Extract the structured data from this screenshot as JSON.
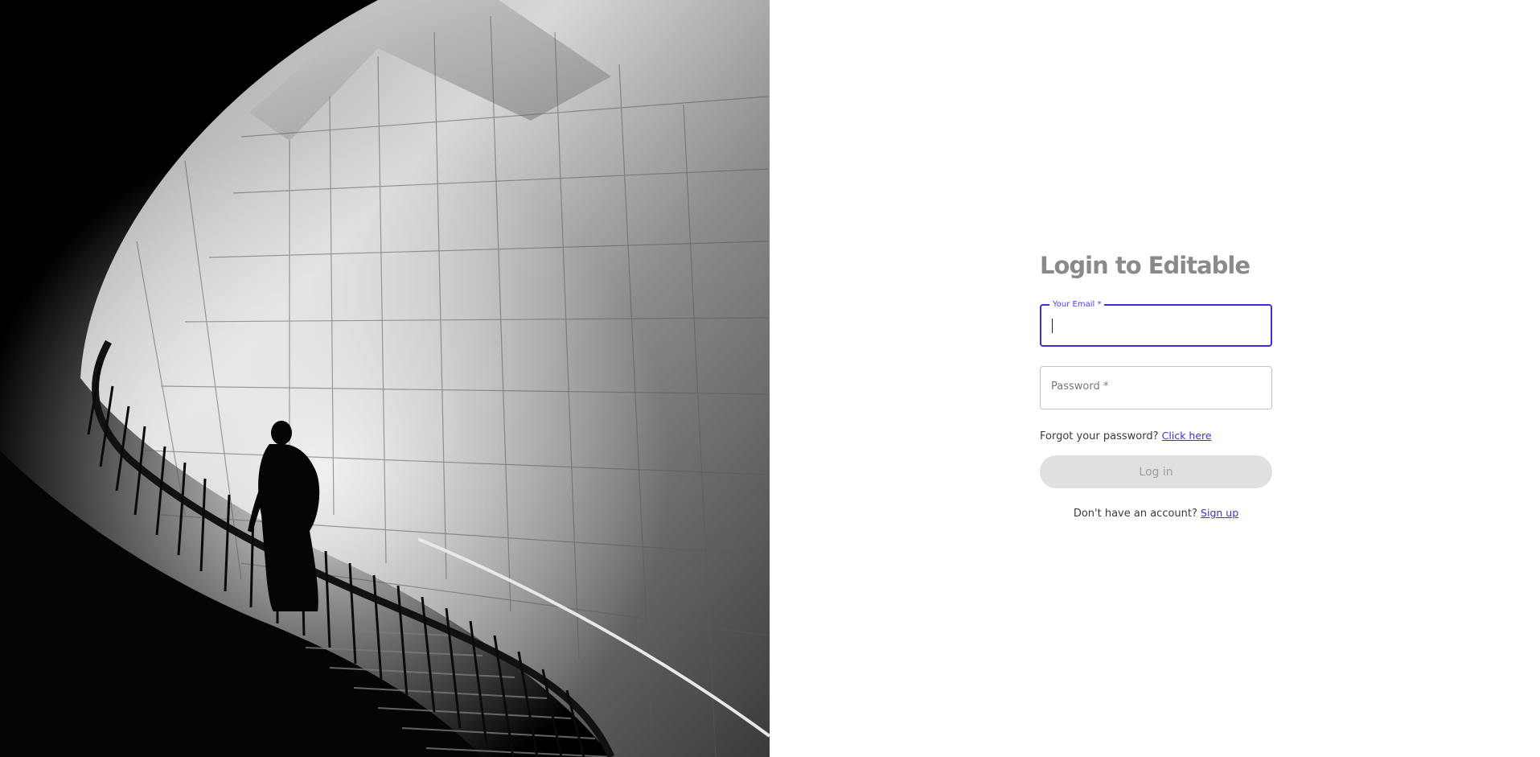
{
  "hero_image": {
    "icon": "staircase-photo"
  },
  "login": {
    "title": "Login to Editable",
    "email": {
      "label": "Your Email *",
      "value": ""
    },
    "password": {
      "placeholder": "Password *",
      "value": ""
    },
    "forgot": {
      "prompt": "Forgot your password?",
      "link_label": "Click here"
    },
    "submit_label": "Log in",
    "signup": {
      "prompt": "Don't have an account?",
      "link_label": "Sign up"
    }
  },
  "colors": {
    "accent": "#3d2fd6",
    "title": "#8a8a8a",
    "button_disabled_bg": "#e0e0e0",
    "button_disabled_text": "#9e9e9e"
  }
}
